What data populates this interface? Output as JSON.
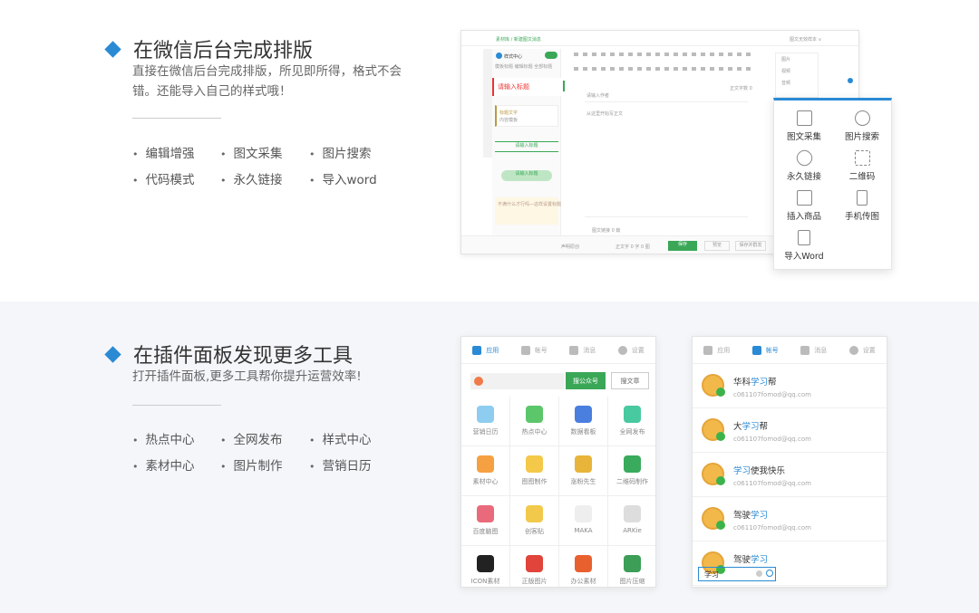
{
  "section1": {
    "title": "在微信后台完成排版",
    "desc": "直接在微信后台完成排版，所见即所得，格式不会错。还能导入自己的样式哦！",
    "features": [
      "编辑增强",
      "图文采集",
      "图片搜索",
      "代码模式",
      "永久链接",
      "导入word"
    ]
  },
  "section2": {
    "title": "在插件面板发现更多工具",
    "desc": "打开插件面板,更多工具帮你提升运营效率!",
    "features": [
      "热点中心",
      "全网发布",
      "样式中心",
      "素材中心",
      "图片制作",
      "营销日历"
    ]
  },
  "editor": {
    "breadcrumb": "素材库 / 新建图文消息",
    "top_right": "图文无效样本 ∨",
    "style_center": "样式中心",
    "tab_labels": "模板标题  编辑标题  全部标题",
    "red_title": "请输入标题",
    "preview_label": "标题文字",
    "item2": "内容模板",
    "green_label1": "请输入标题",
    "green_label2": "请输入标题",
    "note": "不满什么才行吗—这样设置标题",
    "editor_hint1": "请输入作者",
    "editor_hint2": "从这里开始写正文",
    "count": "正文字数 0",
    "orig": "声明原创",
    "reward": "赞赏",
    "save": "保存",
    "preview": "预览",
    "publish": "保存并群发",
    "side_items": [
      "图片",
      "视频",
      "音频",
      "投票"
    ],
    "bottom_right_text": "正文字 0 字 0 图",
    "hint_foot": "图文链接 0 篇"
  },
  "popup": {
    "items": [
      {
        "label": "图文采集",
        "icon": "download-icon"
      },
      {
        "label": "图片搜索",
        "icon": "search-icon"
      },
      {
        "label": "永久链接",
        "icon": "link-icon"
      },
      {
        "label": "二维码",
        "icon": "qrcode-icon"
      },
      {
        "label": "插入商品",
        "icon": "bag-icon"
      },
      {
        "label": "手机传图",
        "icon": "phone-icon"
      },
      {
        "label": "导入Word",
        "icon": "word-icon"
      }
    ]
  },
  "plugin_panel": {
    "tabs": [
      "应用",
      "帐号",
      "消息",
      "设置"
    ],
    "search_btn": "搜公众号",
    "search_article": "搜文章",
    "apps": [
      {
        "label": "营销日历",
        "color": "#8ecdf0"
      },
      {
        "label": "热点中心",
        "color": "#5cc66a"
      },
      {
        "label": "数据看板",
        "color": "#4a7fe0"
      },
      {
        "label": "全网发布",
        "color": "#49c9a0"
      },
      {
        "label": "素材中心",
        "color": "#f5a142"
      },
      {
        "label": "图图制作",
        "color": "#f4c94a"
      },
      {
        "label": "涨粉先生",
        "color": "#e8b43a"
      },
      {
        "label": "二维码制作",
        "color": "#3aab5c"
      },
      {
        "label": "百度脑图",
        "color": "#e96a7a"
      },
      {
        "label": "创客贴",
        "color": "#f2c94a"
      },
      {
        "label": "MAKA",
        "color": "#eeeeee"
      },
      {
        "label": "ARKie",
        "color": "#dddddd"
      },
      {
        "label": "ICON素材",
        "color": "#222222"
      },
      {
        "label": "正版图片",
        "color": "#e0443a"
      },
      {
        "label": "办公素材",
        "color": "#e9602f"
      },
      {
        "label": "图片压缩",
        "color": "#3c9e57"
      }
    ]
  },
  "account_panel": {
    "tabs": [
      "应用",
      "帐号",
      "消息",
      "设置"
    ],
    "accounts": [
      {
        "pre": "华科",
        "hl": "学习",
        "post": "帮",
        "email": "c061107fomod@qq.com"
      },
      {
        "pre": "大",
        "hl": "学习",
        "post": "帮",
        "email": "c061107fomod@qq.com"
      },
      {
        "pre": "",
        "hl": "学习",
        "post": "使我快乐",
        "email": "c061107fomod@qq.com"
      },
      {
        "pre": "驾驶",
        "hl": "学习",
        "post": "",
        "email": "c061107fomod@qq.com"
      },
      {
        "pre": "驾驶",
        "hl": "学习",
        "post": "",
        "email": ""
      }
    ],
    "search_value": "学习"
  }
}
